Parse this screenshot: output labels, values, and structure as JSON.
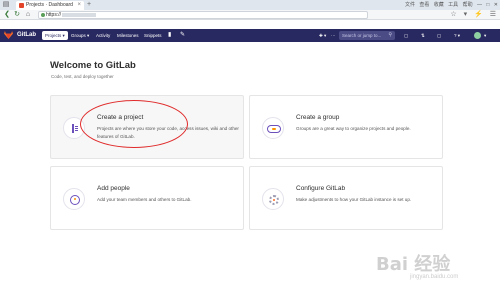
{
  "browser": {
    "tab_title": "Projects · Dashboard",
    "new_tab": "+",
    "tab_close": "×",
    "window_controls": [
      "文件",
      "查看",
      "收藏",
      "工具",
      "帮助",
      "—",
      "□",
      "✕"
    ],
    "url_prefix": "https://",
    "nav_back": "❮",
    "nav_reload": "↻",
    "nav_home": "⌂",
    "addr_icons": [
      "☆",
      "▾",
      "⚡",
      "☰"
    ]
  },
  "gitlab": {
    "brand": "GitLab",
    "nav": {
      "projects": "Projects ▾",
      "groups": "Groups ▾",
      "activity": "Activity",
      "milestones": "Milestones",
      "snippets": "Snippets"
    },
    "nav_icons": {
      "chart": "▮",
      "wrench": "✎"
    },
    "right_icons": {
      "plus": "✚ ▾",
      "dots": "⋯",
      "todo": "▢",
      "mr": "⇅",
      "issue": "▢",
      "help": "? ▾",
      "avatar_caret": "▾"
    },
    "search_placeholder": "Search or jump to...",
    "search_icon": "⚲"
  },
  "welcome": {
    "title": "Welcome to GitLab",
    "subtitle": "Code, test, and deploy together"
  },
  "cards": {
    "create_project": {
      "title": "Create a project",
      "desc": "Projects are where you store your code, access issues, wiki and other features of GitLab."
    },
    "create_group": {
      "title": "Create a group",
      "desc": "Groups are a great way to organize projects and people."
    },
    "add_people": {
      "title": "Add people",
      "desc": "Add your team members and others to GitLab."
    },
    "configure": {
      "title": "Configure GitLab",
      "desc": "Make adjustments to how your GitLab instance is set up."
    }
  },
  "watermark": {
    "main": "Bai 经验",
    "sub": "jingyan.baidu.com"
  },
  "colors": {
    "header": "#292961",
    "accent": "#6b4fbb",
    "orange": "#fc6d26",
    "annotation": "#e02a2a"
  }
}
